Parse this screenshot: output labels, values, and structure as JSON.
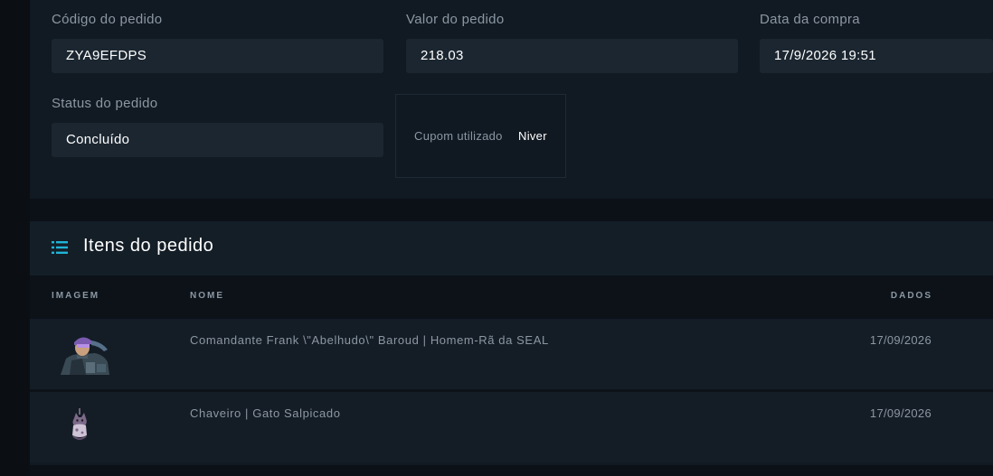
{
  "order": {
    "code_label": "Código do pedido",
    "code_value": "ZYA9EFDPS",
    "value_label": "Valor do pedido",
    "value_value": "218.03",
    "date_label": "Data da compra",
    "date_value": "17/9/2026 19:51",
    "status_label": "Status do pedido",
    "status_value": "Concluído",
    "coupon_label": "Cupom utilizado",
    "coupon_value": "Niver"
  },
  "items_section": {
    "title": "Itens do pedido",
    "icon": "list-icon",
    "columns": {
      "image": "IMAGEM",
      "name": "NOME",
      "date": "DADOS"
    },
    "rows": [
      {
        "image_icon": "agent-character-thumbnail",
        "name": "Comandante Frank \\\"Abelhudo\\\" Baroud | Homem-Rã da SEAL",
        "date": "17/09/2026"
      },
      {
        "image_icon": "keychain-cat-thumbnail",
        "name": "Chaveiro | Gato Salpicado",
        "date": "17/09/2026"
      }
    ]
  },
  "colors": {
    "background": "#0c1117",
    "card": "#111a22",
    "input": "#1b2630",
    "accent": "#1fb5d6",
    "muted_text": "#8b97a3"
  }
}
